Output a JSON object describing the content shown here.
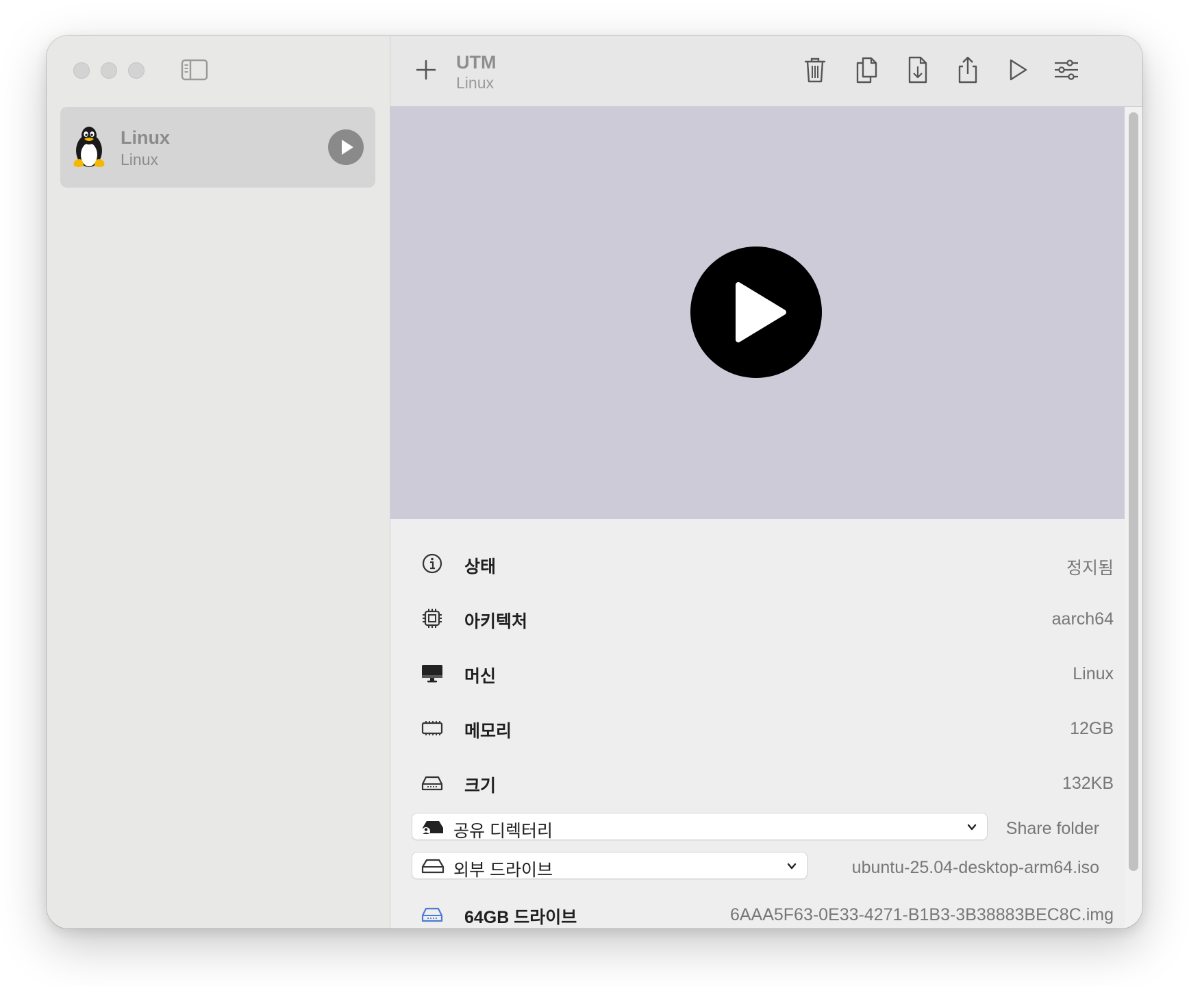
{
  "sidebar": {
    "vm": {
      "name": "Linux",
      "subtitle": "Linux"
    }
  },
  "toolbar": {
    "title": "UTM",
    "subtitle": "Linux"
  },
  "details": {
    "rows": [
      {
        "icon": "info-icon",
        "label": "상태",
        "value": "정지됨"
      },
      {
        "icon": "cpu-icon",
        "label": "아키텍처",
        "value": "aarch64"
      },
      {
        "icon": "display-icon",
        "label": "머신",
        "value": "Linux"
      },
      {
        "icon": "memory-icon",
        "label": "메모리",
        "value": "12GB"
      },
      {
        "icon": "drive-icon",
        "label": "크기",
        "value": "132KB"
      }
    ],
    "shared_directory": {
      "label": "공유 디렉터리",
      "side": "Share folder"
    },
    "external_drive": {
      "label": "외부 드라이브",
      "side": "ubuntu-25.04-desktop-arm64.iso"
    },
    "drive_64": {
      "label": "64GB 드라이브",
      "value": "6AAA5F63-0E33-4271-B1B3-3B38883BEC8C.img"
    }
  },
  "colors": {
    "preview_bg": "#cdcbd7",
    "accent_drive": "#4a7bd8"
  }
}
